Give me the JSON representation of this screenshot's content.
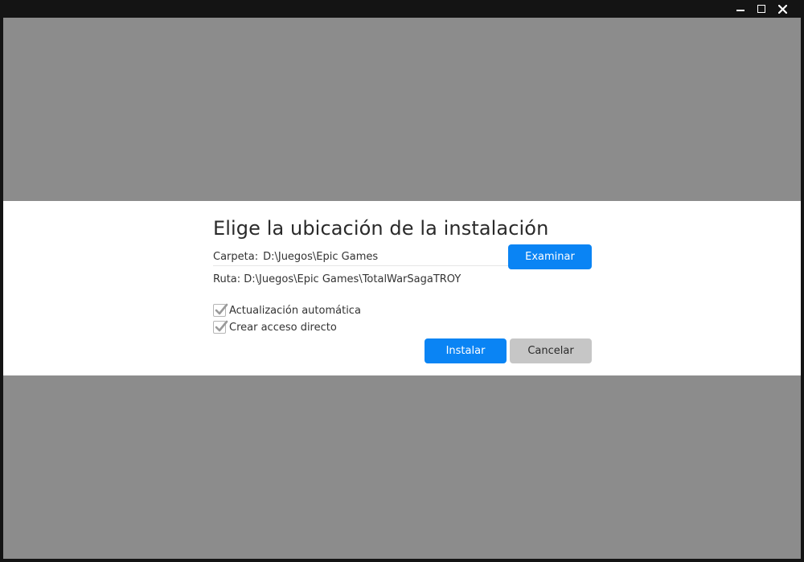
{
  "window": {
    "controls": {
      "minimize_icon": "minimize-icon",
      "maximize_icon": "maximize-icon",
      "close_icon": "close-icon"
    }
  },
  "dialog": {
    "title": "Elige la ubicación de la instalación",
    "folder": {
      "label": "Carpeta:",
      "value": "D:\\Juegos\\Epic Games"
    },
    "browse_label": "Examinar",
    "path": {
      "label": "Ruta:",
      "value": "D:\\Juegos\\Epic Games\\TotalWarSagaTROY"
    },
    "options": [
      {
        "label": "Actualización automática",
        "checked": true
      },
      {
        "label": "Crear acceso directo",
        "checked": true
      }
    ],
    "install_label": "Instalar",
    "cancel_label": "Cancelar"
  },
  "colors": {
    "accent": "#0a84f4",
    "overlay": "#8c8c8c",
    "titlebar": "#141414",
    "secondary_button": "#c6c6c6"
  }
}
